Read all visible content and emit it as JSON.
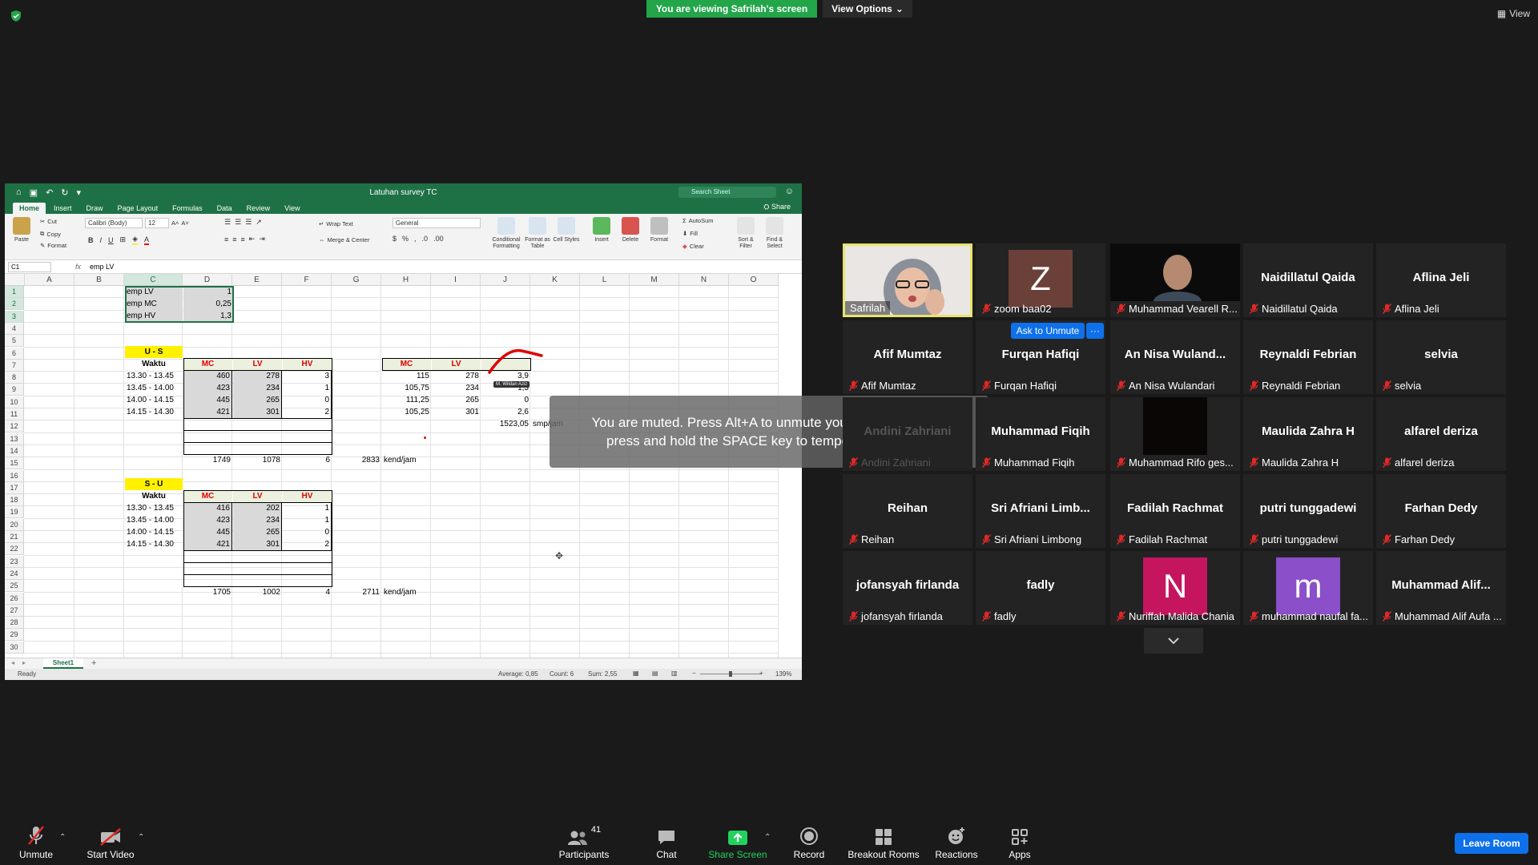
{
  "banner": {
    "viewing": "You are viewing Safrilah's screen",
    "view_options": "View Options",
    "view_label": "View"
  },
  "excel": {
    "title": "Latuhan survey TC",
    "search_placeholder": "Search Sheet",
    "share": "Share",
    "tabs": [
      "Home",
      "Insert",
      "Draw",
      "Page Layout",
      "Formulas",
      "Data",
      "Review",
      "View"
    ],
    "ribbon": {
      "paste": "Paste",
      "cut": "Cut",
      "copy": "Copy",
      "format_painter": "Format",
      "font": "Calibri (Body)",
      "font_size": "12",
      "bold": "B",
      "italic": "I",
      "underline": "U",
      "wrap_text": "Wrap Text",
      "merge_center": "Merge & Center",
      "number_format": "General",
      "percent": "%",
      "conditional_formatting": "Conditional Formatting",
      "format_as_table": "Format as Table",
      "cell_styles": "Cell Styles",
      "insert": "Insert",
      "delete": "Delete",
      "format": "Format",
      "autosum": "AutoSum",
      "fill": "Fill",
      "clear": "Clear",
      "sort_filter": "Sort & Filter",
      "find_select": "Find & Select"
    },
    "name_box": "C1",
    "formula_value": "emp LV",
    "columns": [
      "A",
      "B",
      "C",
      "D",
      "E",
      "F",
      "G",
      "H",
      "I",
      "J",
      "K",
      "L",
      "M",
      "N",
      "O"
    ],
    "rows": [
      "1",
      "2",
      "3",
      "4",
      "5",
      "6",
      "7",
      "8",
      "9",
      "10",
      "11",
      "12",
      "13",
      "14",
      "15",
      "16",
      "17",
      "18",
      "19",
      "20",
      "21",
      "22",
      "23",
      "24",
      "25",
      "26",
      "27",
      "28",
      "29",
      "30"
    ],
    "emp": [
      {
        "label": "emp LV",
        "value": "1"
      },
      {
        "label": "emp MC",
        "value": "0,25"
      },
      {
        "label": "emp HV",
        "value": "1,3"
      }
    ],
    "us": {
      "title": "U - S",
      "header": [
        "Waktu",
        "MC",
        "LV",
        "HV"
      ],
      "rows": [
        [
          "13.30 - 13.45",
          "460",
          "278",
          "3"
        ],
        [
          "13.45 - 14.00",
          "423",
          "234",
          "1"
        ],
        [
          "14.00 - 14.15",
          "445",
          "265",
          "0"
        ],
        [
          "14.15 - 14.30",
          "421",
          "301",
          "2"
        ]
      ],
      "totals": [
        "1749",
        "1078",
        "6"
      ],
      "total_all": "2833",
      "unit": "kend/jam"
    },
    "smp": {
      "header": [
        "MC",
        "LV"
      ],
      "rows": [
        [
          "115",
          "278",
          "3,9"
        ],
        [
          "105,75",
          "234",
          "1,3"
        ],
        [
          "111,25",
          "265",
          "0"
        ],
        [
          "105,25",
          "301",
          "2,6"
        ]
      ],
      "total": "1523,05",
      "unit": "smp/jam"
    },
    "su": {
      "title": "S - U",
      "header": [
        "Waktu",
        "MC",
        "LV",
        "HV"
      ],
      "rows": [
        [
          "13.30 - 13.45",
          "416",
          "202",
          "1"
        ],
        [
          "13.45 - 14.00",
          "423",
          "234",
          "1"
        ],
        [
          "14.00 - 14.15",
          "445",
          "265",
          "0"
        ],
        [
          "14.15 - 14.30",
          "421",
          "301",
          "2"
        ]
      ],
      "totals": [
        "1705",
        "1002",
        "4"
      ],
      "total_all": "2711",
      "unit": "kend/jam"
    },
    "annotator": "M. Wildan Aziz",
    "sheet_tab": "Sheet1",
    "status": {
      "ready": "Ready",
      "average": "Average: 0,85",
      "count": "Count: 6",
      "sum": "Sum: 2,55",
      "zoom": "139%"
    }
  },
  "toast": {
    "line1": "You are muted. Press Alt+A to unmute your microphone, or",
    "line2": "press and hold the SPACE key to temporarily unmute."
  },
  "gallery": {
    "ask_unmute": "Ask to Unmute",
    "more": "···",
    "tiles": [
      {
        "big": "",
        "label": "Safrilah",
        "kind": "video-face",
        "active": true,
        "muted": false
      },
      {
        "big": "",
        "label": "zoom baa02",
        "kind": "avatar",
        "avatar": "Z",
        "avatar_color": "#6b4038",
        "muted": true
      },
      {
        "big": "",
        "label": "Muhammad Vearell R...",
        "kind": "video-man",
        "muted": true
      },
      {
        "big": "Naidillatul Qaida",
        "label": "Naidillatul Qaida",
        "kind": "name",
        "muted": true
      },
      {
        "big": "Aflina Jeli",
        "label": "Aflina Jeli",
        "kind": "name",
        "muted": true
      },
      {
        "big": "Afif Mumtaz",
        "label": "Afif Mumtaz",
        "kind": "name",
        "muted": true
      },
      {
        "big": "Furqan Hafiqi",
        "label": "Furqan Hafiqi",
        "kind": "name",
        "muted": true
      },
      {
        "big": "An Nisa Wuland...",
        "label": "An Nisa Wulandari",
        "kind": "name",
        "muted": true
      },
      {
        "big": "Reynaldi Febrian",
        "label": "Reynaldi Febrian",
        "kind": "name",
        "muted": true
      },
      {
        "big": "selvia",
        "label": "selvia",
        "kind": "name",
        "muted": true
      },
      {
        "big": "Andini Zahriani",
        "label": "Andini Zahriani",
        "kind": "name",
        "muted": true
      },
      {
        "big": "Muhammad Fiqih",
        "label": "Muhammad Fiqih",
        "kind": "name",
        "muted": true
      },
      {
        "big": "",
        "label": "Muhammad Rifo ges...",
        "kind": "video-dark",
        "muted": true
      },
      {
        "big": "Maulida Zahra H",
        "label": "Maulida Zahra H",
        "kind": "name",
        "muted": true
      },
      {
        "big": "alfarel deriza",
        "label": "alfarel deriza",
        "kind": "name",
        "muted": true
      },
      {
        "big": "Reihan",
        "label": "Reihan",
        "kind": "name",
        "muted": true
      },
      {
        "big": "Sri Afriani Limb...",
        "label": "Sri Afriani Limbong",
        "kind": "name",
        "muted": true
      },
      {
        "big": "Fadilah Rachmat",
        "label": "Fadilah Rachmat",
        "kind": "name",
        "muted": true
      },
      {
        "big": "putri tunggadewi",
        "label": "putri tunggadewi",
        "kind": "name",
        "muted": true
      },
      {
        "big": "Farhan Dedy",
        "label": "Farhan Dedy",
        "kind": "name",
        "muted": true
      },
      {
        "big": "jofansyah firlanda",
        "label": "jofansyah firlanda",
        "kind": "name",
        "muted": true
      },
      {
        "big": "fadly",
        "label": "fadly",
        "kind": "name",
        "muted": true
      },
      {
        "big": "",
        "label": "Nuriffah Malida Chania",
        "kind": "avatar",
        "avatar": "N",
        "avatar_color": "#c4155e",
        "muted": true
      },
      {
        "big": "",
        "label": "muhammad naufal fa...",
        "kind": "avatar",
        "avatar": "m",
        "avatar_color": "#8b4fc9",
        "muted": true
      },
      {
        "big": "Muhammad  Alif...",
        "label": "Muhammad Alif Aufa ...",
        "kind": "name",
        "muted": true
      }
    ]
  },
  "toolbar": {
    "unmute": "Unmute",
    "start_video": "Start Video",
    "participants": "Participants",
    "participants_count": "41",
    "chat": "Chat",
    "share_screen": "Share Screen",
    "record": "Record",
    "breakout_rooms": "Breakout Rooms",
    "reactions": "Reactions",
    "apps": "Apps",
    "leave_room": "Leave Room"
  },
  "colors": {
    "excel_green": "#1e7145",
    "zoom_blue": "#0e71eb",
    "banner_green": "#23a54a",
    "active_border": "#e7e36f"
  }
}
